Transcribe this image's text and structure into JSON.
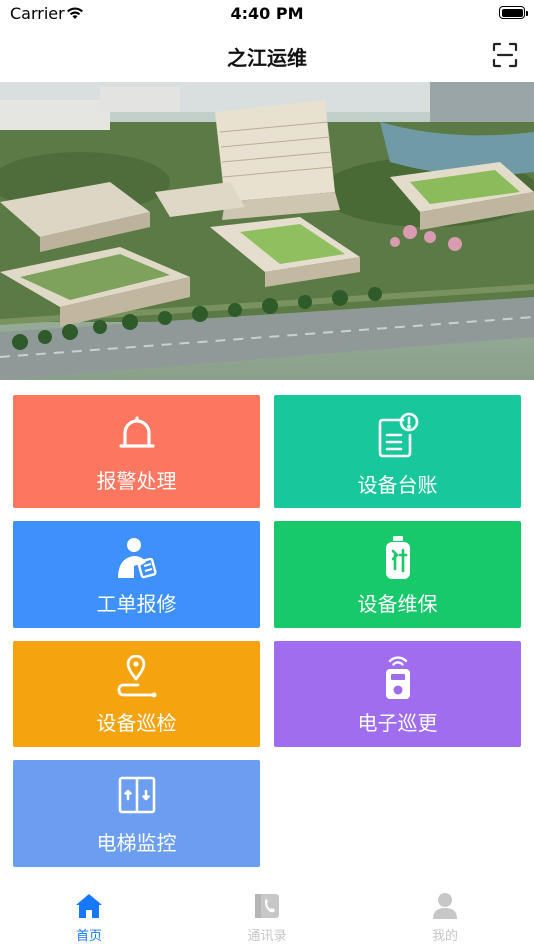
{
  "status_bar": {
    "carrier": "Carrier",
    "time": "4:40 PM"
  },
  "nav": {
    "title": "之江运维",
    "scan_icon": "scan-icon"
  },
  "banner": {
    "description_icon": "campus-aerial-illustration"
  },
  "tiles": [
    {
      "label": "报警处理",
      "icon": "bell-icon",
      "color": "#FD7660"
    },
    {
      "label": "设备台账",
      "icon": "document-alert-icon",
      "color": "#19C79C"
    },
    {
      "label": "工单报修",
      "icon": "worker-repair-icon",
      "color": "#3E90FA"
    },
    {
      "label": "设备维保",
      "icon": "maintenance-tools-icon",
      "color": "#17C96A"
    },
    {
      "label": "设备巡检",
      "icon": "location-route-icon",
      "color": "#F5A30F"
    },
    {
      "label": "电子巡更",
      "icon": "patrol-device-icon",
      "color": "#9F6DED"
    },
    {
      "label": "电梯监控",
      "icon": "elevator-icon",
      "color": "#6B9DF1"
    }
  ],
  "tabs": [
    {
      "label": "首页",
      "icon": "home-icon",
      "active": true
    },
    {
      "label": "通讯录",
      "icon": "contacts-icon",
      "active": false
    },
    {
      "label": "我的",
      "icon": "profile-icon",
      "active": false
    }
  ],
  "colors": {
    "tab_active": "#1677FF",
    "tab_inactive": "#C7C7C7"
  }
}
